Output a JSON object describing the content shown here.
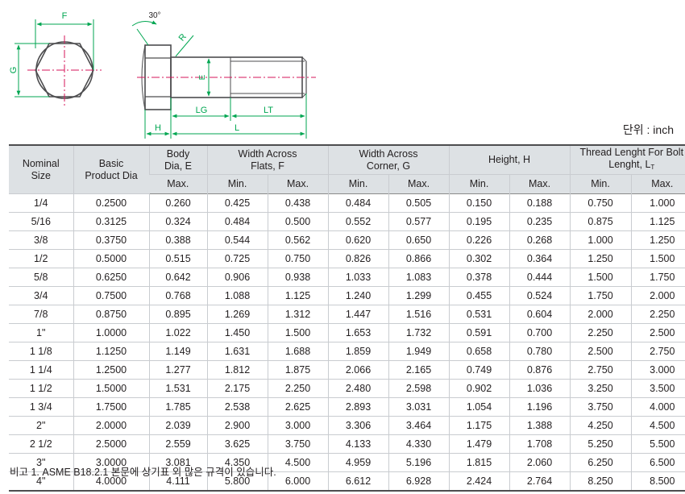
{
  "drawing": {
    "labels": {
      "F": "F",
      "G": "G",
      "angle": "30°",
      "R": "R",
      "E": "E",
      "LG": "LG",
      "LT": "LT",
      "H": "H",
      "L": "L"
    },
    "colors": {
      "bolt_line": "#4d4d4f",
      "center_line": "#d4145a",
      "dimension": "#00a651"
    }
  },
  "unit_label": "단위 : inch",
  "table": {
    "headers": {
      "nominal_size": "Nominal Size",
      "basic_dia": "Basic Product Dia",
      "body_dia": "Body Dia, E",
      "width_flats": "Width Across Flats, F",
      "width_corner": "Width Across Corner, G",
      "height": "Height, H",
      "thread_length": "Thread Lenght For Bolt Lenght, L",
      "thread_sub": "T",
      "min": "Min.",
      "max": "Max."
    },
    "rows": [
      [
        "1/4",
        "0.2500",
        "0.260",
        "0.425",
        "0.438",
        "0.484",
        "0.505",
        "0.150",
        "0.188",
        "0.750",
        "1.000"
      ],
      [
        "5/16",
        "0.3125",
        "0.324",
        "0.484",
        "0.500",
        "0.552",
        "0.577",
        "0.195",
        "0.235",
        "0.875",
        "1.125"
      ],
      [
        "3/8",
        "0.3750",
        "0.388",
        "0.544",
        "0.562",
        "0.620",
        "0.650",
        "0.226",
        "0.268",
        "1.000",
        "1.250"
      ],
      [
        "1/2",
        "0.5000",
        "0.515",
        "0.725",
        "0.750",
        "0.826",
        "0.866",
        "0.302",
        "0.364",
        "1.250",
        "1.500"
      ],
      [
        "5/8",
        "0.6250",
        "0.642",
        "0.906",
        "0.938",
        "1.033",
        "1.083",
        "0.378",
        "0.444",
        "1.500",
        "1.750"
      ],
      [
        "3/4",
        "0.7500",
        "0.768",
        "1.088",
        "1.125",
        "1.240",
        "1.299",
        "0.455",
        "0.524",
        "1.750",
        "2.000"
      ],
      [
        "7/8",
        "0.8750",
        "0.895",
        "1.269",
        "1.312",
        "1.447",
        "1.516",
        "0.531",
        "0.604",
        "2.000",
        "2.250"
      ],
      [
        "1\"",
        "1.0000",
        "1.022",
        "1.450",
        "1.500",
        "1.653",
        "1.732",
        "0.591",
        "0.700",
        "2.250",
        "2.500"
      ],
      [
        "1 1/8",
        "1.1250",
        "1.149",
        "1.631",
        "1.688",
        "1.859",
        "1.949",
        "0.658",
        "0.780",
        "2.500",
        "2.750"
      ],
      [
        "1 1/4",
        "1.2500",
        "1.277",
        "1.812",
        "1.875",
        "2.066",
        "2.165",
        "0.749",
        "0.876",
        "2.750",
        "3.000"
      ],
      [
        "1 1/2",
        "1.5000",
        "1.531",
        "2.175",
        "2.250",
        "2.480",
        "2.598",
        "0.902",
        "1.036",
        "3.250",
        "3.500"
      ],
      [
        "1 3/4",
        "1.7500",
        "1.785",
        "2.538",
        "2.625",
        "2.893",
        "3.031",
        "1.054",
        "1.196",
        "3.750",
        "4.000"
      ],
      [
        "2\"",
        "2.0000",
        "2.039",
        "2.900",
        "3.000",
        "3.306",
        "3.464",
        "1.175",
        "1.388",
        "4.250",
        "4.500"
      ],
      [
        "2 1/2",
        "2.5000",
        "2.559",
        "3.625",
        "3.750",
        "4.133",
        "4.330",
        "1.479",
        "1.708",
        "5.250",
        "5.500"
      ],
      [
        "3\"",
        "3.0000",
        "3.081",
        "4.350",
        "4.500",
        "4.959",
        "5.196",
        "1.815",
        "2.060",
        "6.250",
        "6.500"
      ],
      [
        "4\"",
        "4.0000",
        "4.111",
        "5.800",
        "6.000",
        "6.612",
        "6.928",
        "2.424",
        "2.764",
        "8.250",
        "8.500"
      ]
    ]
  },
  "note": "비고 1.  ASME B18.2.1 본문에 상기표 외 많은 규격이 있습니다."
}
